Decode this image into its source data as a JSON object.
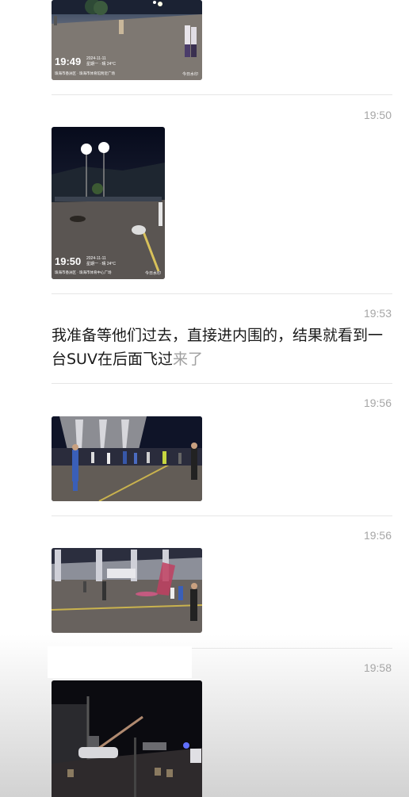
{
  "chat": {
    "messages": [
      {
        "type": "image",
        "stamp_time": "19:49",
        "stamp_date": "2024-11-11",
        "stamp_week": "星期一 · 晴 24°C",
        "stamp_addr": "珠海市香洲区 · 珠海市体育馆附近广场",
        "watermark": "今日水印"
      },
      {
        "type": "image",
        "time": "19:50",
        "stamp_time": "19:50",
        "stamp_date": "2024-11-11",
        "stamp_week": "星期一 · 晴 24°C",
        "stamp_addr": "珠海市香洲区 · 珠海市体育中心广场",
        "watermark": "今日水印"
      },
      {
        "type": "text",
        "time": "19:53",
        "text_main": "我准备等他们过去，直接进内围的，结果就看到一台SUV在后面飞过",
        "text_faded": "来了"
      },
      {
        "type": "image",
        "time": "19:56"
      },
      {
        "type": "image",
        "time": "19:56"
      },
      {
        "type": "image",
        "time": "19:58"
      }
    ]
  }
}
